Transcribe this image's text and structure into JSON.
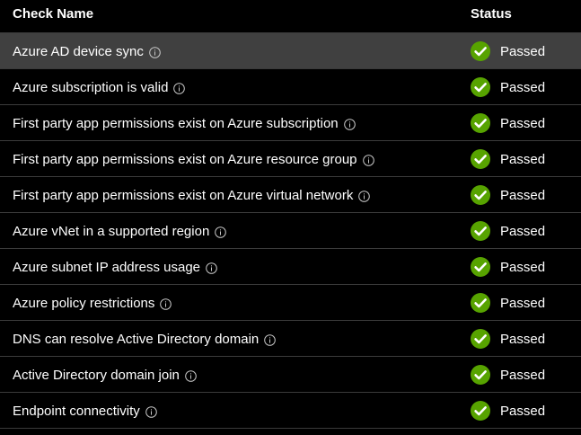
{
  "header": {
    "check_name": "Check Name",
    "status": "Status"
  },
  "colors": {
    "passed_green": "#57a300",
    "selected_row": "#404040",
    "divider": "#3b3b3b"
  },
  "rows": [
    {
      "name": "Azure AD device sync",
      "status": "Passed",
      "status_icon": "check-circle-icon",
      "info_icon": "info-icon",
      "selected": true
    },
    {
      "name": "Azure subscription is valid",
      "status": "Passed",
      "status_icon": "check-circle-icon",
      "info_icon": "info-icon"
    },
    {
      "name": "First party app permissions exist on Azure subscription",
      "status": "Passed",
      "status_icon": "check-circle-icon",
      "info_icon": "info-icon"
    },
    {
      "name": "First party app permissions exist on Azure resource group",
      "status": "Passed",
      "status_icon": "check-circle-icon",
      "info_icon": "info-icon"
    },
    {
      "name": "First party app permissions exist on Azure virtual network",
      "status": "Passed",
      "status_icon": "check-circle-icon",
      "info_icon": "info-icon"
    },
    {
      "name": "Azure vNet in a supported region",
      "status": "Passed",
      "status_icon": "check-circle-icon",
      "info_icon": "info-icon"
    },
    {
      "name": "Azure subnet IP address usage",
      "status": "Passed",
      "status_icon": "check-circle-icon",
      "info_icon": "info-icon"
    },
    {
      "name": "Azure policy restrictions",
      "status": "Passed",
      "status_icon": "check-circle-icon",
      "info_icon": "info-icon"
    },
    {
      "name": "DNS can resolve Active Directory domain",
      "status": "Passed",
      "status_icon": "check-circle-icon",
      "info_icon": "info-icon"
    },
    {
      "name": "Active Directory domain join",
      "status": "Passed",
      "status_icon": "check-circle-icon",
      "info_icon": "info-icon"
    },
    {
      "name": "Endpoint connectivity",
      "status": "Passed",
      "status_icon": "check-circle-icon",
      "info_icon": "info-icon"
    }
  ]
}
